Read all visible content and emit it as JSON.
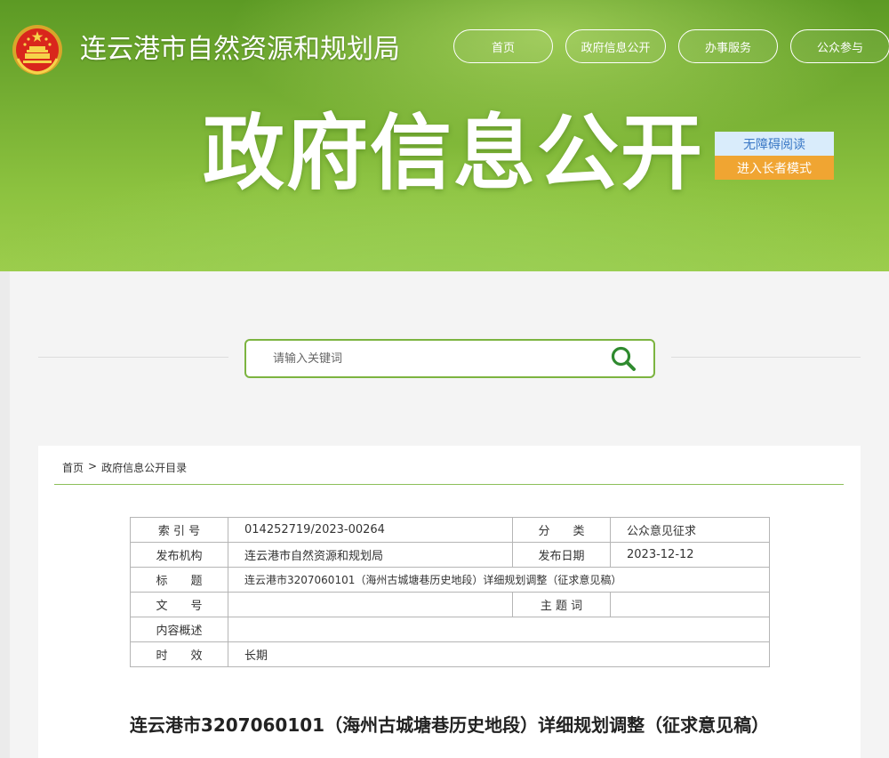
{
  "header": {
    "site_title": "连云港市自然资源和规划局",
    "big_title": "政府信息公开",
    "nav": [
      {
        "label": "首页"
      },
      {
        "label": "政府信息公开"
      },
      {
        "label": "办事服务"
      },
      {
        "label": "公众参与"
      }
    ],
    "accessibility": {
      "barrier_free": "无障碍阅读",
      "elder_mode": "进入长者模式"
    }
  },
  "search": {
    "placeholder": "请输入关键词"
  },
  "breadcrumb": {
    "home": "首页",
    "separator": ">",
    "current": "政府信息公开目录"
  },
  "meta": {
    "index_label": "索 引 号",
    "index_value": "014252719/2023-00264",
    "category_label": "分　　类",
    "category_value": "公众意见征求",
    "publisher_label": "发布机构",
    "publisher_value": "连云港市自然资源和规划局",
    "date_label": "发布日期",
    "date_value": "2023-12-12",
    "title_label": "标　　题",
    "title_value": "连云港市3207060101（海州古城塘巷历史地段）详细规划调整（征求意见稿）",
    "docno_label": "文　　号",
    "docno_value": "",
    "subject_label": "主 题 词",
    "subject_value": "",
    "summary_label": "内容概述",
    "summary_value": "",
    "validity_label": "时　　效",
    "validity_value": "长期"
  },
  "document": {
    "title": "连云港市3207060101（海州古城塘巷历史地段）详细规划调整（征求意见稿）"
  },
  "colors": {
    "accent_green": "#7cb440",
    "elder_orange": "#f0a532",
    "barrier_blue": "#3a78c6"
  }
}
